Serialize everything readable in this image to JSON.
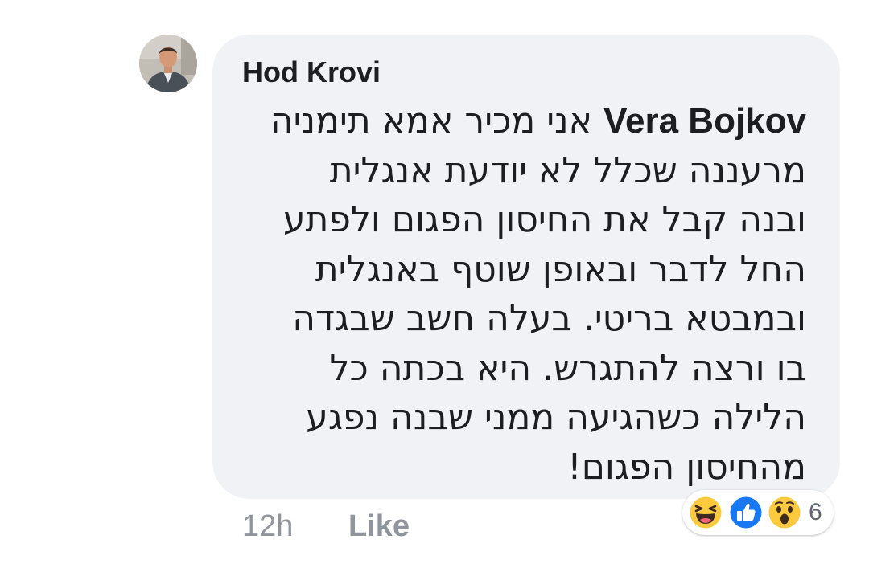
{
  "comment": {
    "author": "Hod Krovi",
    "mention": "Vera Bojkov",
    "first_line_text": "אני מכיר אמא תימניה",
    "lines": [
      "מרעננה שכלל לא יודעת אנגלית",
      "ובנה קבל את החיסון הפגום ולפתע",
      "החל לדבר ובאופן שוטף באנגלית",
      "ובמבטא בריטי. בעלה חשב שבגדה",
      "בו ורצה להתגרש. היא בכתה כל",
      "הלילה כשהגיעה ממני שבנה נפגע",
      "מהחיסון הפגום!"
    ],
    "timestamp": "12h",
    "like_label": "Like",
    "reactions": {
      "icons": [
        "haha-icon",
        "like-icon",
        "wow-icon"
      ],
      "count": "6"
    }
  },
  "colors": {
    "bubble": "#f0f2f5",
    "text": "#1c1e21",
    "meta": "#90949c",
    "like_blue": "#1877f2",
    "emoji_yellow": "#fcc93f"
  }
}
